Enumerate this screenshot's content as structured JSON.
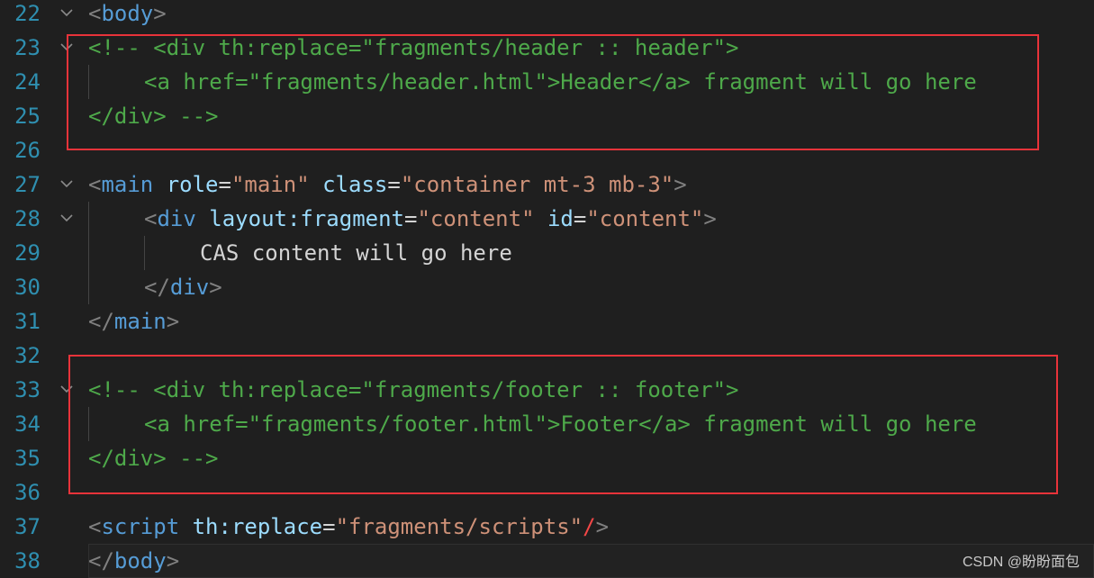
{
  "editor": {
    "lines": [
      {
        "num": "22",
        "fold": true,
        "indent": 0,
        "tokens": [
          [
            "pu",
            "<"
          ],
          [
            "tg",
            "body"
          ],
          [
            "pu",
            ">"
          ]
        ]
      },
      {
        "num": "23",
        "fold": true,
        "indent": 0,
        "tokens": [
          [
            "cm",
            "<!-- <div th:replace=\"fragments/header :: header\">"
          ]
        ]
      },
      {
        "num": "24",
        "fold": false,
        "indent": 1,
        "tokens": [
          [
            "cm",
            "<a href=\"fragments/header.html\">Header</a> fragment will go here"
          ]
        ]
      },
      {
        "num": "25",
        "fold": false,
        "indent": 0,
        "tokens": [
          [
            "cm",
            "</div> -->"
          ]
        ]
      },
      {
        "num": "26",
        "fold": false,
        "indent": 0,
        "tokens": []
      },
      {
        "num": "27",
        "fold": true,
        "indent": 0,
        "tokens": [
          [
            "pu",
            "<"
          ],
          [
            "tg",
            "main"
          ],
          [
            "tx",
            " "
          ],
          [
            "at",
            "role"
          ],
          [
            "tx",
            "="
          ],
          [
            "st",
            "\"main\""
          ],
          [
            "tx",
            " "
          ],
          [
            "at",
            "class"
          ],
          [
            "tx",
            "="
          ],
          [
            "st",
            "\"container mt-3 mb-3\""
          ],
          [
            "pu",
            ">"
          ]
        ]
      },
      {
        "num": "28",
        "fold": true,
        "indent": 1,
        "tokens": [
          [
            "pu",
            "<"
          ],
          [
            "tg",
            "div"
          ],
          [
            "tx",
            " "
          ],
          [
            "at",
            "layout:fragment"
          ],
          [
            "tx",
            "="
          ],
          [
            "st",
            "\"content\""
          ],
          [
            "tx",
            " "
          ],
          [
            "at",
            "id"
          ],
          [
            "tx",
            "="
          ],
          [
            "st",
            "\"content\""
          ],
          [
            "pu",
            ">"
          ]
        ]
      },
      {
        "num": "29",
        "fold": false,
        "indent": 2,
        "tokens": [
          [
            "tx",
            "CAS content will go here"
          ]
        ]
      },
      {
        "num": "30",
        "fold": false,
        "indent": 1,
        "tokens": [
          [
            "pu",
            "</"
          ],
          [
            "tg",
            "div"
          ],
          [
            "pu",
            ">"
          ]
        ]
      },
      {
        "num": "31",
        "fold": false,
        "indent": 0,
        "tokens": [
          [
            "pu",
            "</"
          ],
          [
            "tg",
            "main"
          ],
          [
            "pu",
            ">"
          ]
        ]
      },
      {
        "num": "32",
        "fold": false,
        "indent": 0,
        "tokens": []
      },
      {
        "num": "33",
        "fold": true,
        "indent": 0,
        "tokens": [
          [
            "cm",
            "<!-- <div th:replace=\"fragments/footer :: footer\">"
          ]
        ]
      },
      {
        "num": "34",
        "fold": false,
        "indent": 1,
        "tokens": [
          [
            "cm",
            "<a href=\"fragments/footer.html\">Footer</a> fragment will go here"
          ]
        ]
      },
      {
        "num": "35",
        "fold": false,
        "indent": 0,
        "tokens": [
          [
            "cm",
            "</div> -->"
          ]
        ]
      },
      {
        "num": "36",
        "fold": false,
        "indent": 0,
        "tokens": []
      },
      {
        "num": "37",
        "fold": false,
        "indent": 0,
        "tokens": [
          [
            "pu",
            "<"
          ],
          [
            "tg",
            "script"
          ],
          [
            "tx",
            " "
          ],
          [
            "at",
            "th:replace"
          ],
          [
            "tx",
            "="
          ],
          [
            "st",
            "\"fragments/scripts\""
          ],
          [
            "er",
            "/"
          ],
          [
            "pu",
            ">"
          ]
        ]
      },
      {
        "num": "38",
        "fold": false,
        "indent": 0,
        "current": true,
        "tokens": [
          [
            "pu",
            "</"
          ],
          [
            "tg",
            "body"
          ],
          [
            "pu",
            ">"
          ]
        ]
      }
    ]
  },
  "annotations": {
    "header_box_label": "header-comment-highlight",
    "footer_box_label": "footer-comment-highlight",
    "highlight_color": "#e8333a"
  },
  "watermark": "CSDN @盼盼面包"
}
